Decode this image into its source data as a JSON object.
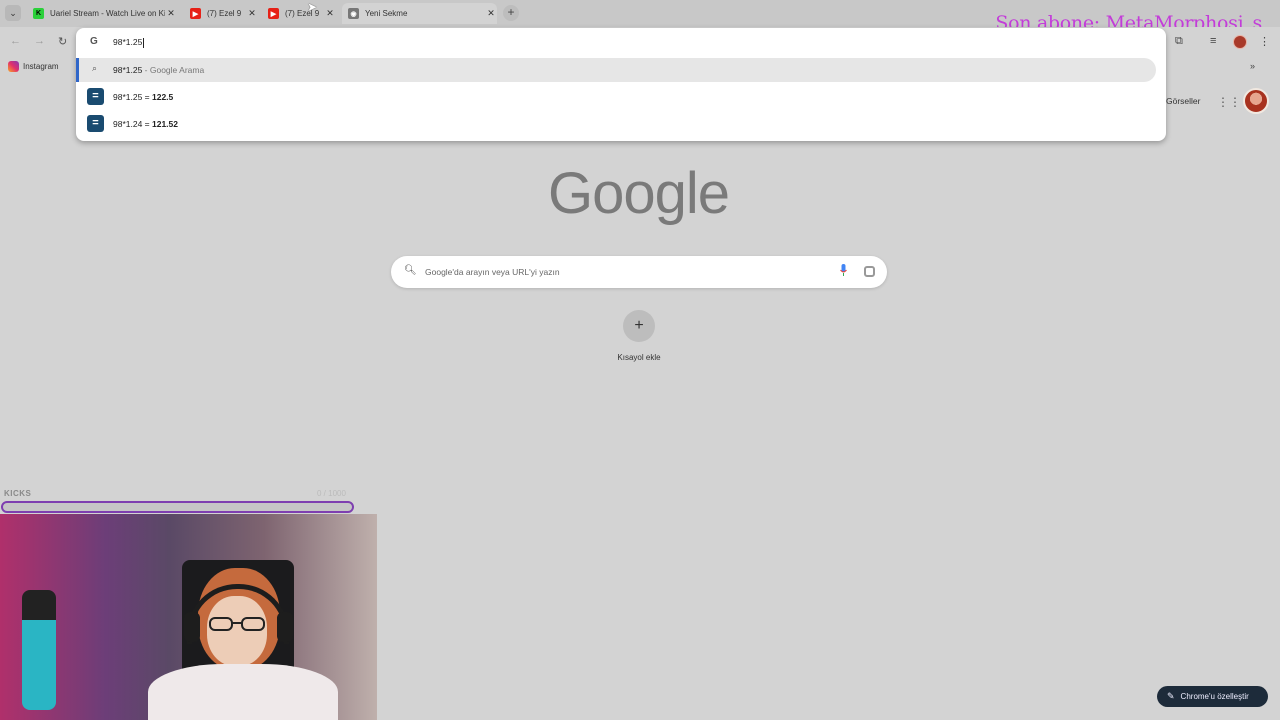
{
  "tabs": [
    {
      "label": "Uariel Stream - Watch Live on Kick",
      "favicon": "kick-icon",
      "active": false
    },
    {
      "label": "(7) Ezel 9",
      "favicon": "youtube-icon",
      "active": false
    },
    {
      "label": "(7) Ezel 9",
      "favicon": "youtube-icon",
      "active": false
    },
    {
      "label": "Yeni Sekme",
      "favicon": "chrome-icon",
      "active": true
    }
  ],
  "overlay": {
    "last_subscriber": "Son abone: MetaMorphosi_s"
  },
  "bookmarks": [
    {
      "label": "Instagram",
      "icon": "instagram-icon"
    }
  ],
  "omnibox": {
    "input_value": "98*1.25",
    "search_suggestion": {
      "query": "98*1.25",
      "suffix": " - Google Arama"
    },
    "calc_results": [
      {
        "expression": "98*1.25 = ",
        "result": "122.5"
      },
      {
        "expression": "98*1.24 = ",
        "result": "121.52"
      }
    ]
  },
  "header": {
    "images_link": "Görseller"
  },
  "logo_text": "Google",
  "search": {
    "placeholder": "Google'da arayın veya URL'yi yazın"
  },
  "shortcut": {
    "label": "Kısayol ekle"
  },
  "kicks": {
    "label": "KICKS",
    "count": "0 / 1000",
    "progress": 0
  },
  "customize": {
    "label": "Chrome'u özelleştir"
  },
  "colors": {
    "overlay_accent": "#c33cd9",
    "suggest_accent": "#2f66c9",
    "calc_icon_bg": "#1a4b70"
  }
}
